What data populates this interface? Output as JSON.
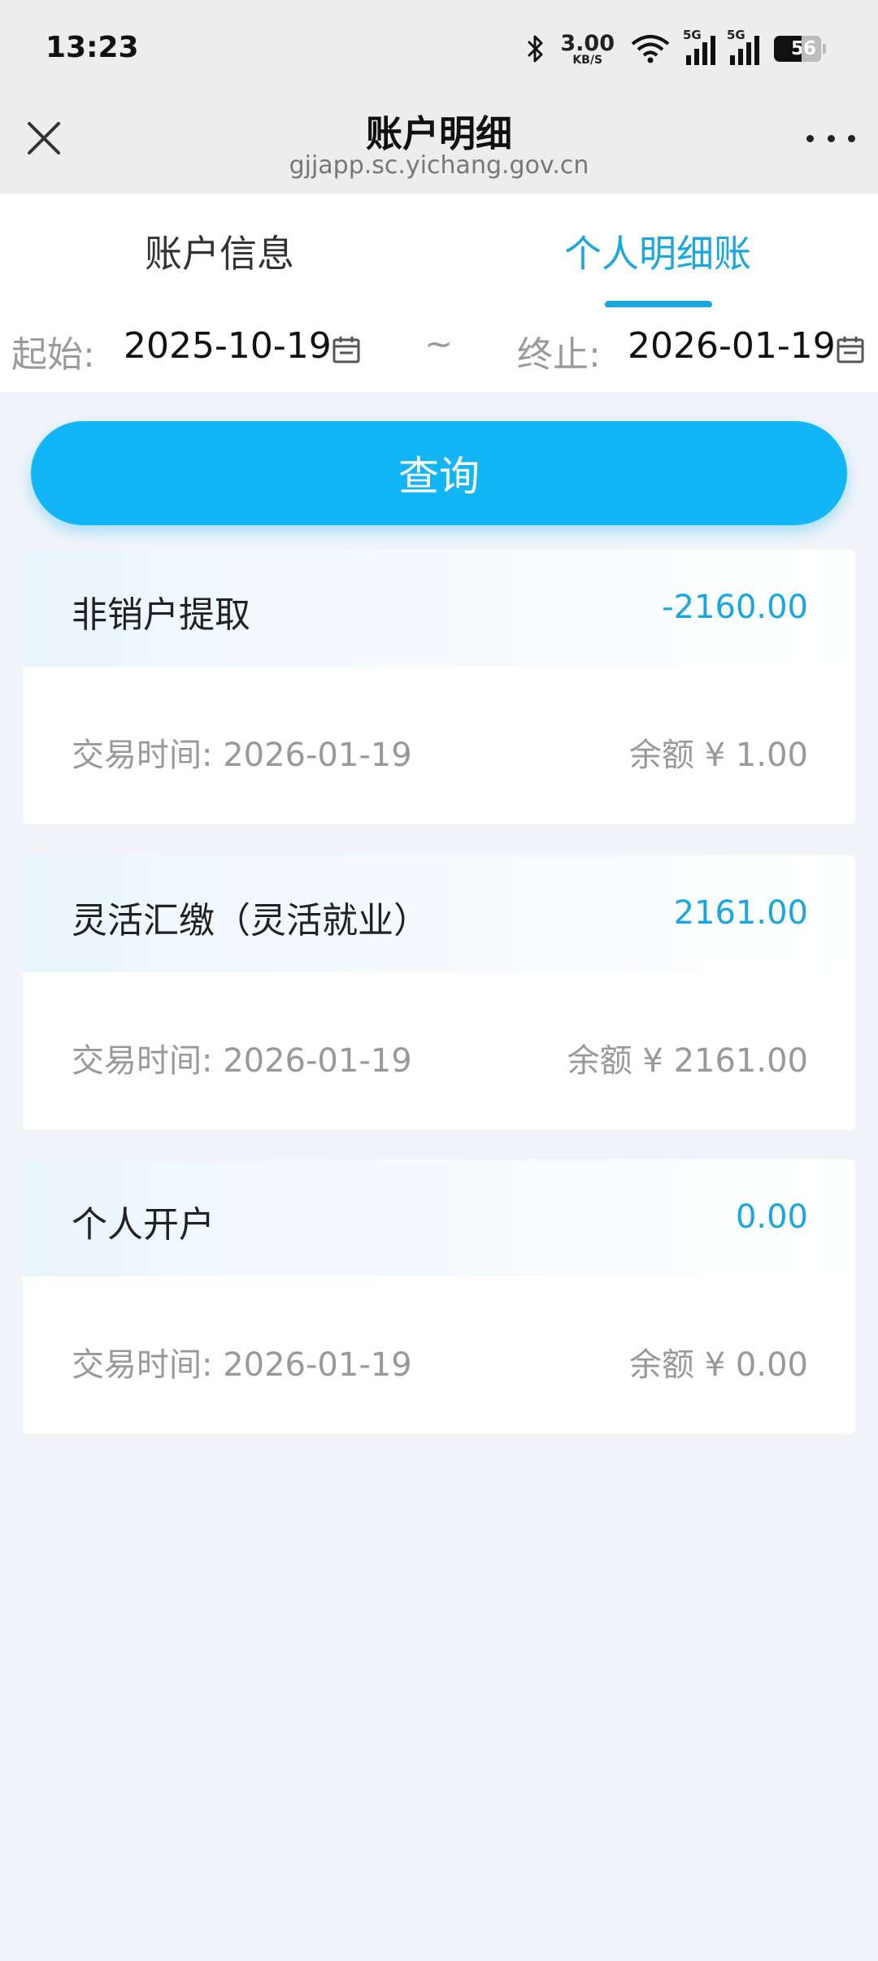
{
  "status_bar": {
    "time": "13:23",
    "net_speed_value": "3.00",
    "net_speed_unit": "KB/S",
    "signal1_label": "5G",
    "signal2_label": "5G",
    "battery_level": "5",
    "battery_rest": "6",
    "icons": [
      "bluetooth-icon",
      "wifi-icon",
      "signal-icon",
      "battery-icon"
    ]
  },
  "navbar": {
    "title": "账户明细",
    "subtitle": "gjjapp.sc.yichang.gov.cn",
    "icons": [
      "close-icon",
      "more-icon"
    ]
  },
  "tabs": [
    {
      "label": "账户信息",
      "active": false
    },
    {
      "label": "个人明细账",
      "active": true
    }
  ],
  "date_range": {
    "start_label": "起始:",
    "start_value": "2025-10-19",
    "separator": "~",
    "end_label": "终止:",
    "end_value": "2026-01-19"
  },
  "query_button": "查询",
  "records": [
    {
      "type": "非销户提取",
      "amount": "-2160.00",
      "time": "交易时间: 2026-01-19",
      "balance": "余额 ¥ 1.00"
    },
    {
      "type": "灵活汇缴（灵活就业）",
      "amount": "2161.00",
      "time": "交易时间: 2026-01-19",
      "balance": "余额 ¥ 2161.00"
    },
    {
      "type": "个人开户",
      "amount": "0.00",
      "time": "交易时间: 2026-01-19",
      "balance": "余额 ¥ 0.00"
    }
  ],
  "colors": {
    "accent": "#1aa7e0",
    "button": "#12b5f5",
    "page_bg": "#f2f4f9"
  }
}
